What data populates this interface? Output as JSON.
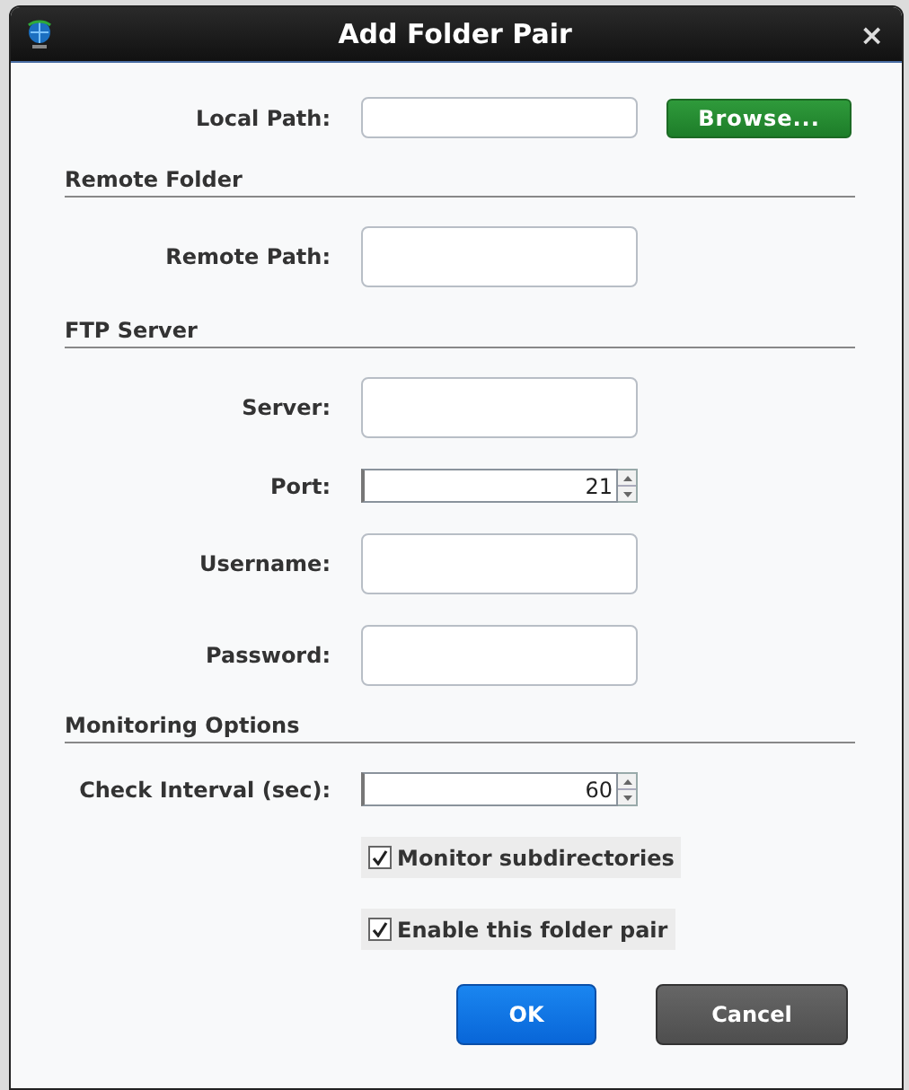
{
  "window": {
    "title": "Add Folder Pair",
    "close": "×"
  },
  "local_path": {
    "label": "Local Path:",
    "button": "Browse..."
  },
  "sections": [
    {
      "title": "Remote Folder",
      "fields": [
        {
          "label": "Remote Path:",
          "kind": "text"
        }
      ]
    },
    {
      "title": "FTP Server",
      "fields": [
        {
          "label": "Server:",
          "kind": "text"
        },
        {
          "label": "Port:",
          "kind": "spinner",
          "value": "21"
        },
        {
          "label": "Username:",
          "kind": "text"
        },
        {
          "label": "Password:",
          "kind": "text"
        }
      ]
    },
    {
      "title": "Monitoring Options",
      "fields": [
        {
          "label": "Check Interval (sec):",
          "kind": "spinner",
          "value": "60"
        }
      ],
      "checkboxes": [
        {
          "label": "Monitor subdirectories",
          "checked": true
        },
        {
          "label": "Enable this folder pair",
          "checked": true
        }
      ]
    }
  ],
  "buttons": [
    {
      "label": "OK",
      "kind": "primary"
    },
    {
      "label": "Cancel",
      "kind": "secondary"
    }
  ]
}
